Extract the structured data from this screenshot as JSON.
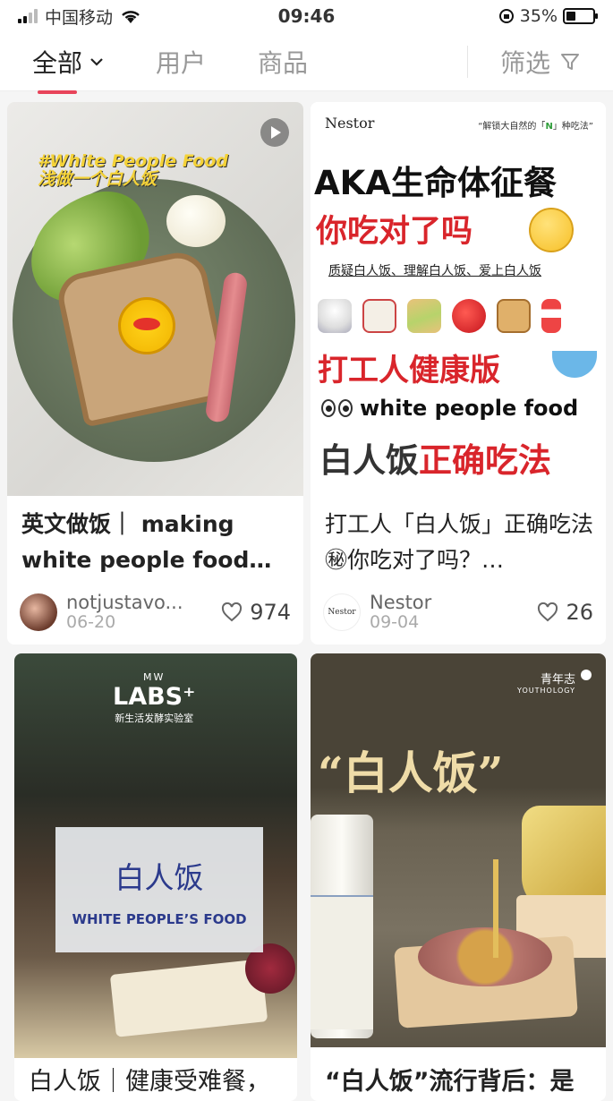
{
  "status": {
    "carrier": "中国移动",
    "time": "09:46",
    "battery": "35%",
    "battery_level": 0.35
  },
  "tabs": [
    {
      "label": "全部"
    },
    {
      "label": "用户"
    },
    {
      "label": "商品"
    }
  ],
  "filter_label": "筛选",
  "cards": [
    {
      "image_text": "#White People Food\n浅做一个白人饭",
      "title": "英文做饭｜ making white people food…",
      "author": "notjustavo...",
      "date": "06-20",
      "likes": "974"
    },
    {
      "logo": "Nestor",
      "slogan_pre": "“解锁大自然的「",
      "slogan_n": "N",
      "slogan_post": "」种吃法”",
      "line1": "AKA生命体征餐",
      "line2": "你吃对了吗",
      "line3": "质疑白人饭、理解白人饭、爱上白人饭",
      "line4": "打工人健康版",
      "line5": "white people food",
      "line6_a": "白人饭",
      "line6_b": "正确吃法",
      "title": "打工人「白人饭」正确吃法㊙你吃对了吗？…",
      "author": "Nestor",
      "date": "09-04",
      "likes": "26"
    },
    {
      "labs_mw": "MW",
      "labs_big": "LABS⁺",
      "labs_sub": "新生活发酵实验室",
      "panel_title": "白人饭",
      "panel_sub": "WHITE PEOPLE’S FOOD",
      "title_peek": "白人饭｜健康受难餐，"
    },
    {
      "logo_cn": "青年志",
      "logo_en": "YOUTHOLOGY",
      "quote_title": "“白人饭”",
      "title_peek": "“白人饭”流行背后：是"
    }
  ]
}
